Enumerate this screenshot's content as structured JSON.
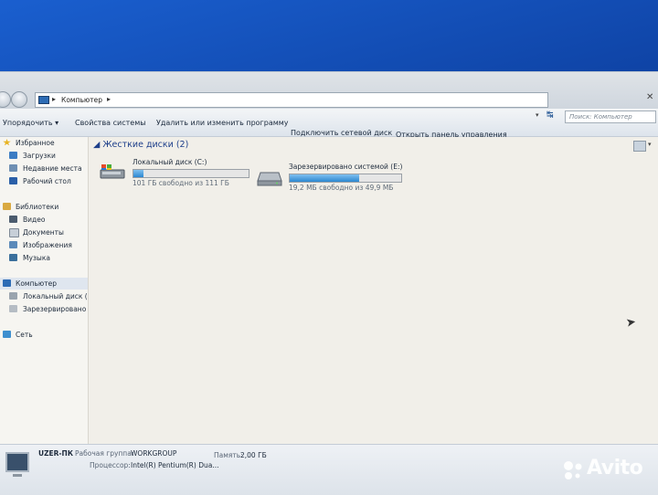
{
  "address_bar": {
    "path": "Компьютер",
    "search_placeholder": "Поиск: Компьютер"
  },
  "toolbar": {
    "organize": "Упорядочить ▾",
    "system_properties": "Свойства системы",
    "uninstall": "Удалить или изменить программу",
    "map_drive": "Подключить сетевой диск",
    "control_panel": "Открыть панель управления"
  },
  "nav": {
    "favorites": "Избранное",
    "downloads": "Загрузки",
    "recent": "Недавние места",
    "desktop": "Рабочий стол",
    "libraries": "Библиотеки",
    "video": "Видео",
    "documents": "Документы",
    "pictures": "Изображения",
    "music": "Музыка",
    "computer": "Компьютер",
    "local_disk": "Локальный диск (С",
    "reserved": "Зарезервировано с",
    "network": "Сеть"
  },
  "content": {
    "group_header": "Жесткие диски (2)",
    "drives": [
      {
        "name": "Локальный диск (C:)",
        "free_text": "101 ГБ свободно из 111 ГБ",
        "used_fraction": 0.09
      },
      {
        "name": "Зарезервировано системой (E:)",
        "free_text": "19,2 МБ свободно из 49,9 МБ",
        "used_fraction": 0.62
      }
    ]
  },
  "details": {
    "computer_name": "UZER-ПК",
    "workgroup_label": "Рабочая группа:",
    "workgroup_value": "WORKGROUP",
    "memory_label": "Память:",
    "memory_value": "2,00 ГБ",
    "processor_label": "Процессор:",
    "processor_value": "Intel(R) Pentium(R) Dua..."
  },
  "watermark": "Avito",
  "colors": {
    "accent": "#1e3f8a",
    "bar_fill": "#2b87d1"
  }
}
